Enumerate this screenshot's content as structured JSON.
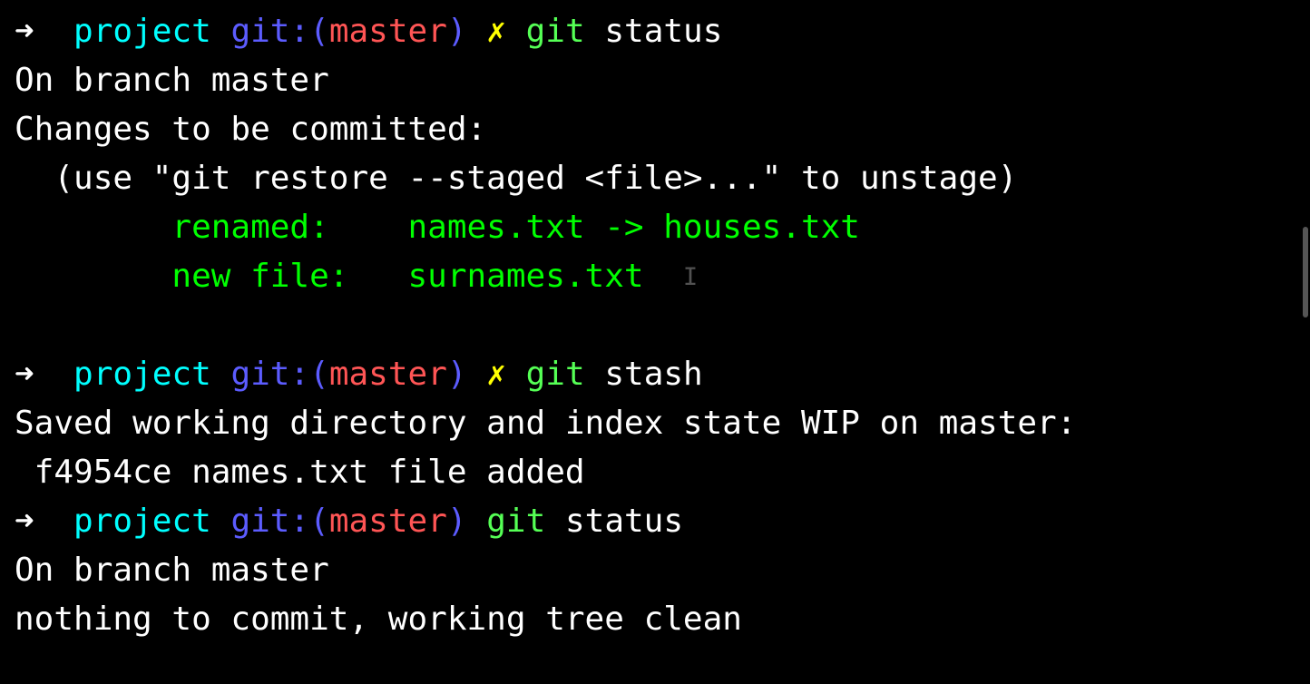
{
  "prompt1": {
    "arrow": "➜",
    "dir": "project",
    "git_label": "git:(",
    "branch": "master",
    "git_close": ")",
    "dirty": "✗",
    "cmd_git": "git",
    "cmd_args": "status"
  },
  "output1": {
    "on_branch": "On branch master",
    "changes_header": "Changes to be committed:",
    "unstage_hint": "  (use \"git restore --staged <file>...\" to unstage)",
    "renamed_label": "        renamed:    ",
    "renamed_value": "names.txt -> houses.txt",
    "newfile_label": "        new file:   ",
    "newfile_value": "surnames.txt  ",
    "cursor_mark": "I"
  },
  "prompt2": {
    "arrow": "➜",
    "dir": "project",
    "git_label": "git:(",
    "branch": "master",
    "git_close": ")",
    "dirty": "✗",
    "cmd_git": "git",
    "cmd_args": "stash"
  },
  "output2": {
    "line1": "Saved working directory and index state WIP on master:",
    "line2": " f4954ce names.txt file added"
  },
  "prompt3": {
    "arrow": "➜",
    "dir": "project",
    "git_label": "git:(",
    "branch": "master",
    "git_close": ")",
    "cmd_git": "git",
    "cmd_args": "status"
  },
  "output3": {
    "on_branch": "On branch master",
    "clean": "nothing to commit, working tree clean"
  }
}
